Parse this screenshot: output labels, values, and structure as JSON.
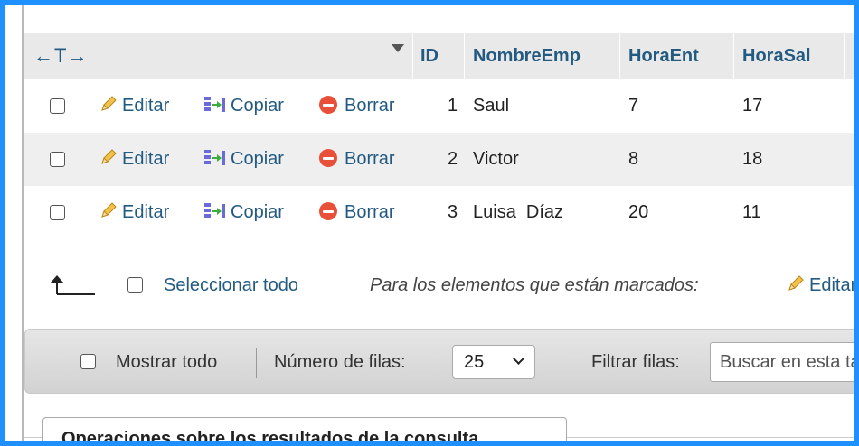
{
  "header": {
    "nav_arrows": "←T→",
    "columns": [
      "ID",
      "NombreEmp",
      "HoraEnt",
      "HoraSal"
    ]
  },
  "actions": {
    "edit_label": "Editar",
    "copy_label": "Copiar",
    "delete_label": "Borrar"
  },
  "rows": [
    {
      "id": "1",
      "nombre": "Saul",
      "hora_ent": "7",
      "hora_sal": "17"
    },
    {
      "id": "2",
      "nombre": "Victor",
      "hora_ent": "8",
      "hora_sal": "18"
    },
    {
      "id": "3",
      "nombre": "Luisa  Díaz",
      "hora_ent": "20",
      "hora_sal": "11"
    }
  ],
  "bulk": {
    "select_all_label": "Seleccionar todo",
    "marked_label": "Para los elementos que están marcados:",
    "edit_label": "Editar"
  },
  "navbar": {
    "show_all_label": "Mostrar todo",
    "rows_label": "Número de filas:",
    "rows_value": "25",
    "filter_label": "Filtrar filas:",
    "search_placeholder": "Buscar en esta tabla"
  },
  "operations": {
    "title": "Operaciones sobre los resultados de la consulta"
  },
  "colors": {
    "frame": "#1e90ff",
    "link": "#235a81",
    "delete": "#e8503a"
  }
}
